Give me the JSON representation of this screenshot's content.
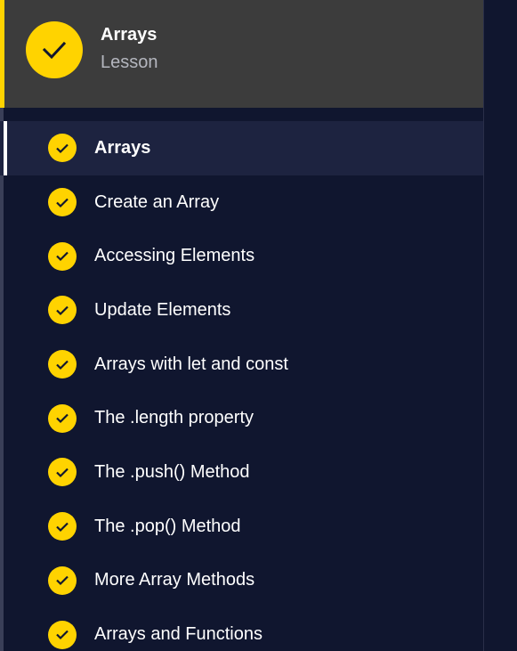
{
  "lesson": {
    "title": "Arrays",
    "subtitle": "Lesson",
    "status_icon": "check-icon"
  },
  "colors": {
    "accent": "#ffd300",
    "header_bg": "#3c3c3c",
    "panel_bg": "#10162f",
    "active_bg": "#1d2340"
  },
  "items": [
    {
      "label": "Arrays",
      "completed": true,
      "active": true
    },
    {
      "label": "Create an Array",
      "completed": true,
      "active": false
    },
    {
      "label": "Accessing Elements",
      "completed": true,
      "active": false
    },
    {
      "label": "Update Elements",
      "completed": true,
      "active": false
    },
    {
      "label": "Arrays with let and const",
      "completed": true,
      "active": false
    },
    {
      "label": "The .length property",
      "completed": true,
      "active": false
    },
    {
      "label": "The .push() Method",
      "completed": true,
      "active": false
    },
    {
      "label": "The .pop() Method",
      "completed": true,
      "active": false
    },
    {
      "label": "More Array Methods",
      "completed": true,
      "active": false
    },
    {
      "label": "Arrays and Functions",
      "completed": true,
      "active": false
    }
  ]
}
